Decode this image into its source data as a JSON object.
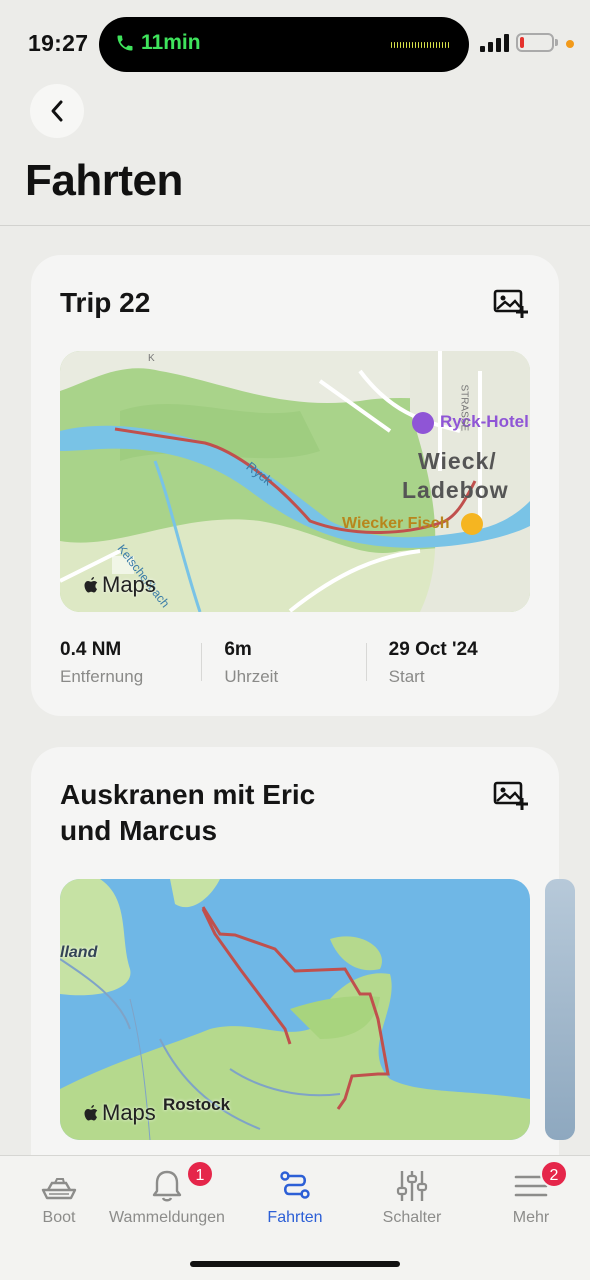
{
  "status_bar": {
    "time": "19:27",
    "call_duration": "11min"
  },
  "header": {
    "title": "Fahrten",
    "back_icon": "chevron-left-icon"
  },
  "trips": [
    {
      "title": "Trip 22",
      "map": {
        "labels": {
          "hotel": "Ryck-Hotel",
          "town_line1": "Wieck/",
          "town_line2": "Ladebow",
          "shop": "Wiecker Fisch",
          "river": "Ryck",
          "stream": "Ketschenbach",
          "street": "STRASSE",
          "edge": "K"
        },
        "attribution": "Maps"
      },
      "stats": [
        {
          "value": "0.4 NM",
          "label": "Entfernung"
        },
        {
          "value": "6m",
          "label": "Uhrzeit"
        },
        {
          "value": "29 Oct '24",
          "label": "Start"
        }
      ]
    },
    {
      "title": "Auskranen mit Eric und Marcus",
      "map": {
        "labels": {
          "city": "Rostock",
          "region": "lland"
        },
        "attribution": "Maps"
      }
    }
  ],
  "tabbar": {
    "tabs": [
      {
        "label": "Boot",
        "icon": "boat-icon",
        "active": false
      },
      {
        "label": "Wammeldungen",
        "icon": "bell-icon",
        "badge": "1",
        "active": false
      },
      {
        "label": "Fahrten",
        "icon": "route-icon",
        "active": true
      },
      {
        "label": "Schalter",
        "icon": "sliders-icon",
        "active": false
      },
      {
        "label": "Mehr",
        "icon": "menu-icon",
        "badge": "2",
        "active": false
      }
    ]
  },
  "colors": {
    "accent": "#2c5fd6",
    "track": "#c0504d",
    "badge": "#e5264a"
  }
}
